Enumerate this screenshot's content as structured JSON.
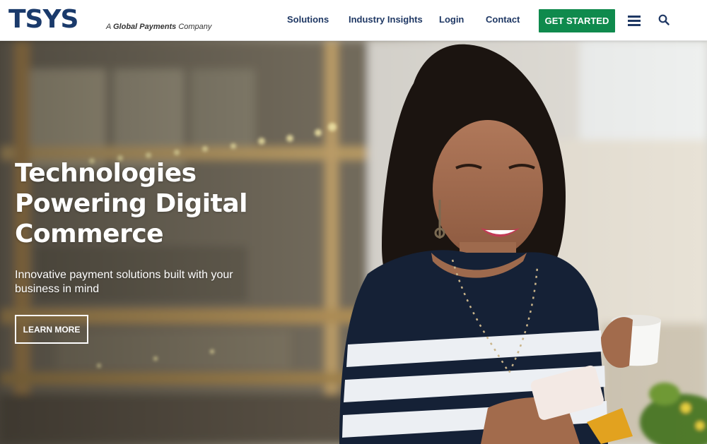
{
  "brand": {
    "logo_text": "TSYS",
    "tagline_prefix": "A ",
    "tagline_bold": "Global Payments",
    "tagline_suffix": " Company"
  },
  "nav": {
    "solutions": "Solutions",
    "industry_insights": "Industry Insights",
    "login": "Login",
    "contact": "Contact",
    "cta": "GET STARTED"
  },
  "hero": {
    "title_lines": [
      "Technologies",
      "Powering Digital",
      "Commerce"
    ],
    "subtitle": "Innovative payment solutions built with your business in mind",
    "button": "LEARN MORE"
  },
  "colors": {
    "brand_navy": "#1a3a6b",
    "nav_text": "#1f3864",
    "cta_green": "#0f8a4d"
  },
  "icons": [
    "menu-icon",
    "search-icon"
  ]
}
